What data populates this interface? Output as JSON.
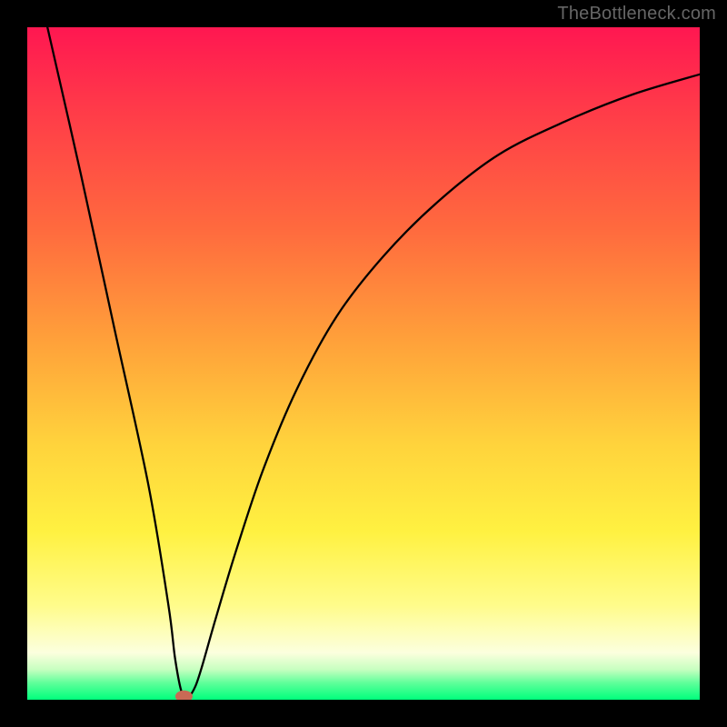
{
  "watermark": "TheBottleneck.com",
  "chart_data": {
    "type": "line",
    "title": "",
    "xlabel": "",
    "ylabel": "",
    "x_range": [
      0,
      100
    ],
    "y_range": [
      0,
      100
    ],
    "curve": {
      "comment": "V-shaped bottleneck curve. Left branch is steep/linear, bottoms near x≈23 y≈0, right branch rises concave toward y≈93 at x=100. Values estimated from pixels (0–100 normalized).",
      "x": [
        3,
        8,
        13,
        18,
        21,
        22,
        23,
        24,
        25,
        26,
        28,
        31,
        35,
        40,
        46,
        53,
        61,
        70,
        80,
        90,
        100
      ],
      "y": [
        100,
        78,
        55,
        32,
        14,
        6,
        1,
        0.5,
        2,
        5,
        12,
        22,
        34,
        46,
        57,
        66,
        74,
        81,
        86,
        90,
        93
      ]
    },
    "marker": {
      "x": 23.3,
      "y": 0.5,
      "color": "#c96a55"
    },
    "gradient_stops": [
      {
        "pos": 0.0,
        "color": "#ff1751"
      },
      {
        "pos": 0.3,
        "color": "#ff6a3e"
      },
      {
        "pos": 0.62,
        "color": "#ffd33c"
      },
      {
        "pos": 0.86,
        "color": "#fffc8b"
      },
      {
        "pos": 0.96,
        "color": "#c7ffc0"
      },
      {
        "pos": 1.0,
        "color": "#00ff7c"
      }
    ]
  }
}
